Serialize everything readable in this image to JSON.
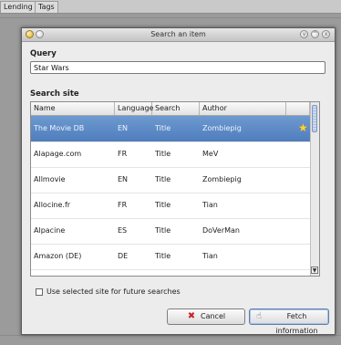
{
  "background": {
    "tabs": [
      "Lending",
      "Tags"
    ]
  },
  "dialog": {
    "title": "Search an item",
    "query_label": "Query",
    "query_value": "Star Wars",
    "search_site_label": "Search site",
    "columns": [
      "Name",
      "Language",
      "Search fields",
      "Author"
    ],
    "rows": [
      {
        "name": "The Movie DB",
        "language": "EN",
        "fields": "Title",
        "author": "Zombiepig",
        "selected": true,
        "favorite": true
      },
      {
        "name": "Alapage.com",
        "language": "FR",
        "fields": "Title",
        "author": "MeV"
      },
      {
        "name": "Allmovie",
        "language": "EN",
        "fields": "Title",
        "author": "Zombiepig"
      },
      {
        "name": "Allocine.fr",
        "language": "FR",
        "fields": "Title",
        "author": "Tian"
      },
      {
        "name": "Alpacine",
        "language": "ES",
        "fields": "Title",
        "author": "DoVerMan"
      },
      {
        "name": "Amazon (DE)",
        "language": "DE",
        "fields": "Title",
        "author": "Tian"
      }
    ],
    "remember_label": "Use selected site for future searches",
    "remember_checked": false,
    "cancel_label": "Cancel",
    "fetch_label": "Fetch information"
  },
  "icons": {
    "cancel": "x-icon",
    "fetch": "fetch-icon",
    "favorite": "star-icon"
  },
  "colors": {
    "selection": "#5683c2",
    "star": "#ffd23a"
  }
}
